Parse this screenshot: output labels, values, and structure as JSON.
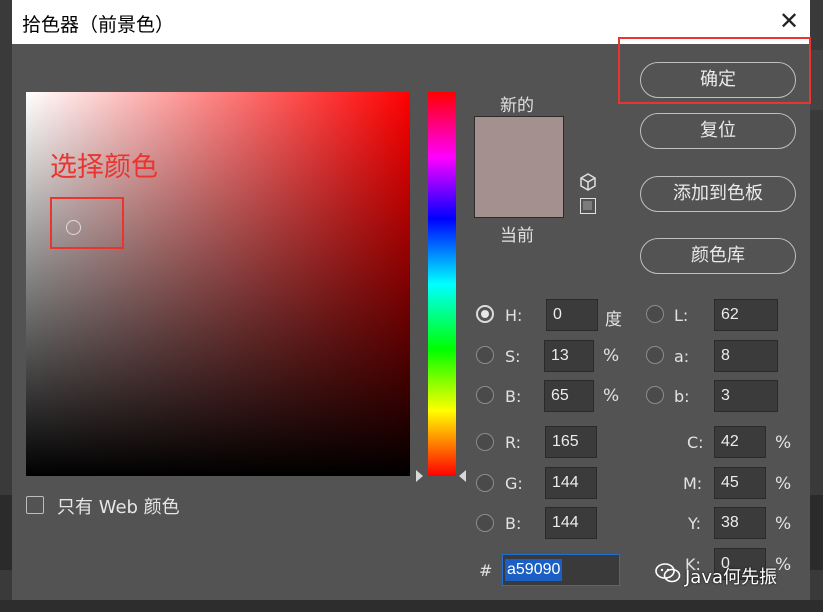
{
  "window": {
    "title": "拾色器（前景色）",
    "close_label": "✕"
  },
  "annotation": {
    "text": "选择颜色",
    "color": "#e8352f"
  },
  "preview": {
    "new_label": "新的",
    "current_label": "当前",
    "new_color": "#a59090",
    "current_color": "#a59090"
  },
  "buttons": {
    "ok": "确定",
    "reset": "复位",
    "add_to_swatches": "添加到色板",
    "color_libraries": "颜色库"
  },
  "web_only": {
    "label": "只有 Web 颜色",
    "checked": false
  },
  "hsb": {
    "h": {
      "label": "H:",
      "value": "0",
      "unit": "度",
      "selected": true
    },
    "s": {
      "label": "S:",
      "value": "13",
      "unit": "%",
      "selected": false
    },
    "b": {
      "label": "B:",
      "value": "65",
      "unit": "%",
      "selected": false
    }
  },
  "lab": {
    "l": {
      "label": "L:",
      "value": "62"
    },
    "a": {
      "label": "a:",
      "value": "8"
    },
    "b": {
      "label": "b:",
      "value": "3"
    }
  },
  "rgb": {
    "r": {
      "label": "R:",
      "value": "165"
    },
    "g": {
      "label": "G:",
      "value": "144"
    },
    "b": {
      "label": "B:",
      "value": "144"
    }
  },
  "cmyk": {
    "c": {
      "label": "C:",
      "value": "42",
      "unit": "%"
    },
    "m": {
      "label": "M:",
      "value": "45",
      "unit": "%"
    },
    "y": {
      "label": "Y:",
      "value": "38",
      "unit": "%"
    },
    "k": {
      "label": "K:",
      "value": "0",
      "unit": "%"
    }
  },
  "hex": {
    "label": "#",
    "value": "a59090"
  },
  "watermark": {
    "text": "Java何先振"
  },
  "icons": {
    "close": "close-icon",
    "gamut": "cube-icon",
    "web_safe": "web-safe-icon",
    "wechat": "wechat-icon"
  }
}
